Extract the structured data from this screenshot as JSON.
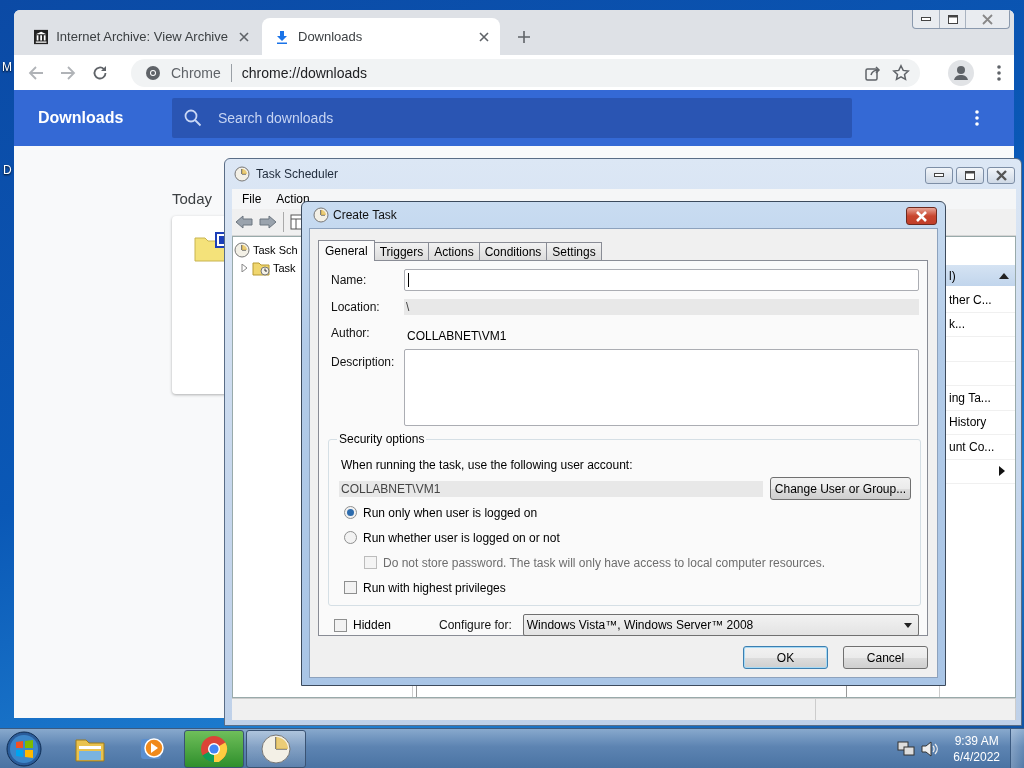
{
  "desktop": {
    "icon_labels": [
      "M",
      "D"
    ]
  },
  "browser": {
    "tabs": [
      {
        "title": "Internet Archive: View Archive",
        "kind": "archive",
        "selected": false
      },
      {
        "title": "Downloads",
        "kind": "download",
        "selected": true
      }
    ],
    "omnibox": {
      "chip": "Chrome",
      "url": "chrome://downloads"
    },
    "page": {
      "title": "Downloads",
      "search_placeholder": "Search downloads",
      "section": "Today"
    }
  },
  "task_scheduler": {
    "title": "Task Scheduler",
    "menu": [
      "File",
      "Action"
    ],
    "tree": [
      {
        "label": "Task Sch",
        "children": [
          {
            "label": "Task",
            "expanded": false
          }
        ]
      }
    ],
    "actions_pane": {
      "header": "l)",
      "items": [
        {
          "kind": "text",
          "label": "ther C..."
        },
        {
          "kind": "text",
          "label": "k..."
        },
        {
          "kind": "empty"
        },
        {
          "kind": "empty"
        },
        {
          "kind": "text",
          "label": "ing Ta..."
        },
        {
          "kind": "text",
          "label": "History"
        },
        {
          "kind": "text",
          "label": "unt Co..."
        },
        {
          "kind": "submenu"
        }
      ]
    }
  },
  "dialog": {
    "title": "Create Task",
    "tabs": [
      {
        "label": "General",
        "selected": true
      },
      {
        "label": "Triggers",
        "selected": false
      },
      {
        "label": "Actions",
        "selected": false
      },
      {
        "label": "Conditions",
        "selected": false
      },
      {
        "label": "Settings",
        "selected": false
      }
    ],
    "name": {
      "label": "Name:",
      "focused": true
    },
    "location": {
      "label": "Location:",
      "value": "\\"
    },
    "author": {
      "label": "Author:",
      "value": "COLLABNET\\VM1"
    },
    "description": {
      "label": "Description:"
    },
    "security": {
      "title": "Security options",
      "account_prompt": "When running the task, use the following user account:",
      "account": "COLLABNET\\VM1",
      "change_button": "Change User or Group...",
      "options": [
        {
          "kind": "radio",
          "label": "Run only when user is logged on",
          "selected": true
        },
        {
          "kind": "radio",
          "label": "Run whether user is logged on or not",
          "selected": false,
          "children": [
            {
              "kind": "checkbox",
              "label": "Do not store password.  The task will only have access to local computer resources.",
              "checked": false,
              "disabled": true
            }
          ]
        },
        {
          "kind": "checkbox",
          "label": "Run with highest privileges",
          "checked": false,
          "disabled": false
        }
      ]
    },
    "hidden": {
      "label": "Hidden",
      "checked": false
    },
    "configure": {
      "label": "Configure for:",
      "value": "Windows Vista™, Windows Server™ 2008"
    },
    "buttons": [
      {
        "label": "OK",
        "default": true
      },
      {
        "label": "Cancel",
        "default": false
      }
    ]
  },
  "taskbar": {
    "apps": [
      {
        "kind": "explorer",
        "running": false,
        "hovered": false
      },
      {
        "kind": "media",
        "running": false,
        "hovered": false
      },
      {
        "kind": "chrome",
        "running": true,
        "hovered": true
      },
      {
        "kind": "scheduler",
        "running": true,
        "hovered": false
      }
    ],
    "time": "9:39 AM",
    "date": "6/4/2022"
  }
}
